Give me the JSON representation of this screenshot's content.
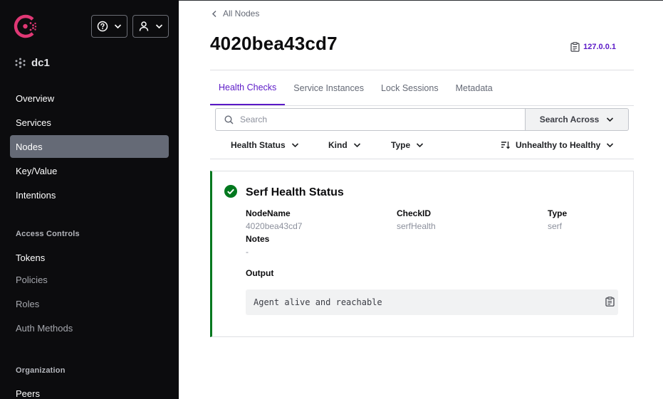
{
  "sidebar": {
    "datacenter": "dc1",
    "nav_primary": [
      {
        "label": "Overview",
        "active": false
      },
      {
        "label": "Services",
        "active": false
      },
      {
        "label": "Nodes",
        "active": true
      },
      {
        "label": "Key/Value",
        "active": false
      },
      {
        "label": "Intentions",
        "active": false
      }
    ],
    "access_controls_heading": "Access Controls",
    "access_controls": [
      {
        "label": "Tokens"
      },
      {
        "label": "Policies"
      },
      {
        "label": "Roles"
      },
      {
        "label": "Auth Methods"
      }
    ],
    "organization_heading": "Organization",
    "organization": [
      {
        "label": "Peers"
      }
    ]
  },
  "breadcrumb": {
    "back_label": "All Nodes"
  },
  "node": {
    "name": "4020bea43cd7",
    "address": "127.0.0.1"
  },
  "tabs": [
    {
      "label": "Health Checks",
      "active": true
    },
    {
      "label": "Service Instances",
      "active": false
    },
    {
      "label": "Lock Sessions",
      "active": false
    },
    {
      "label": "Metadata",
      "active": false
    }
  ],
  "search": {
    "placeholder": "Search",
    "across_label": "Search Across"
  },
  "filters": {
    "health_status": "Health Status",
    "kind": "Kind",
    "type": "Type",
    "sort": "Unhealthy to Healthy"
  },
  "check": {
    "title": "Serf Health Status",
    "status": "passing",
    "node_name_label": "NodeName",
    "node_name": "4020bea43cd7",
    "check_id_label": "CheckID",
    "check_id": "serfHealth",
    "type_label": "Type",
    "type": "serf",
    "notes_label": "Notes",
    "notes": "-",
    "output_label": "Output",
    "output": "Agent alive and reachable"
  },
  "colors": {
    "accent": "#5b19c7",
    "sidebar_bg": "#0c0c0e",
    "active_nav_bg": "#656a76",
    "passing": "#00781e",
    "brand": "#e03875"
  },
  "icons": {
    "logo": "consul-logo-icon",
    "help": "help-icon",
    "user": "user-icon",
    "datacenter": "datacenter-icon",
    "copy": "clipboard-copy-icon",
    "sort": "sort-icon",
    "check": "check-circle-icon"
  }
}
